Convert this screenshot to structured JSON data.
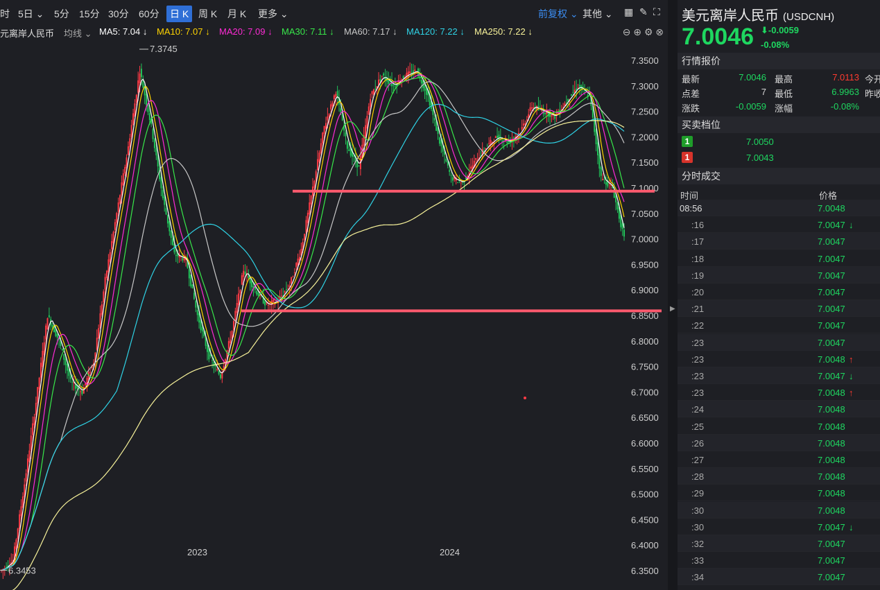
{
  "toolbar": {
    "items": [
      "时",
      "5日 ⌄",
      "5分",
      "15分",
      "30分",
      "60分",
      "日 K",
      "周 K",
      "月 K",
      "更多 ⌄"
    ],
    "active_index": 6,
    "adjust": "前复权 ⌄",
    "other": "其他 ⌄"
  },
  "ma_bar": {
    "symbol": "元离岸人民币",
    "mode": "均线 ⌄",
    "ma": [
      {
        "label": "MA5: 7.04 ↓",
        "color": "#ffffff"
      },
      {
        "label": "MA10: 7.07 ↓",
        "color": "#ffd400"
      },
      {
        "label": "MA20: 7.09 ↓",
        "color": "#ff2bd6"
      },
      {
        "label": "MA30: 7.11 ↓",
        "color": "#38e84a"
      },
      {
        "label": "MA60: 7.17 ↓",
        "color": "#c8c8c8"
      },
      {
        "label": "MA120: 7.22 ↓",
        "color": "#2fd3e6"
      },
      {
        "label": "MA250: 7.22 ↓",
        "color": "#f7f29a"
      }
    ]
  },
  "chart_data": {
    "type": "candlestick",
    "y_ticks": [
      "7.3500",
      "7.3000",
      "7.2500",
      "7.2000",
      "7.1500",
      "7.1000",
      "7.0500",
      "7.0000",
      "6.9500",
      "6.9000",
      "6.8500",
      "6.8000",
      "6.7500",
      "6.7000",
      "6.6500",
      "6.6000",
      "6.5500",
      "6.5000",
      "6.4500",
      "6.4000",
      "6.3500"
    ],
    "ylim": [
      6.33,
      7.39
    ],
    "x_labels": [
      "2023",
      "2024"
    ],
    "high_marker": "7.3745",
    "low_marker": "6.3453",
    "high_value": 7.3745,
    "low_value": 6.3453,
    "support_lines": [
      7.0935,
      6.859
    ],
    "price_path": [
      6.35,
      6.37,
      6.52,
      6.68,
      6.85,
      6.8,
      6.72,
      6.7,
      6.76,
      6.92,
      7.05,
      7.18,
      7.33,
      7.22,
      7.08,
      6.97,
      6.96,
      6.85,
      6.77,
      6.73,
      6.82,
      6.94,
      6.9,
      6.87,
      6.88,
      6.91,
      6.98,
      7.1,
      7.22,
      7.29,
      7.18,
      7.14,
      7.28,
      7.32,
      7.3,
      7.32,
      7.33,
      7.28,
      7.19,
      7.12,
      7.11,
      7.15,
      7.18,
      7.2,
      7.19,
      7.21,
      7.26,
      7.25,
      7.24,
      7.27,
      7.3,
      7.28,
      7.12,
      7.1,
      7.0
    ]
  },
  "quote": {
    "title": "美元离岸人民币",
    "code": "(USDCNH)",
    "price": "7.0046",
    "change": "⬇-0.0059",
    "change_pct": "-0.08%",
    "section": "行情报价",
    "rows": [
      {
        "l1": "最新",
        "v1": "7.0046",
        "c1": "green",
        "l2": "最高",
        "v2": "7.0113",
        "c2": "red",
        "l3": "今开"
      },
      {
        "l1": "点差",
        "v1": "7",
        "c1": "plain",
        "l2": "最低",
        "v2": "6.9963",
        "c2": "green",
        "l3": "昨收"
      },
      {
        "l1": "涨跌",
        "v1": "-0.0059",
        "c1": "green",
        "l2": "涨幅",
        "v2": "-0.08%",
        "c2": "green",
        "l3": ""
      }
    ]
  },
  "orderbook": {
    "section": "买卖档位",
    "levels": [
      {
        "badge": "1",
        "price": "7.0050",
        "color": "#1f9d2a"
      },
      {
        "badge": "1",
        "price": "7.0043",
        "color": "#d7332b"
      }
    ]
  },
  "trades": {
    "section": "分时成交",
    "col_time": "时间",
    "col_price": "价格",
    "rows": [
      {
        "time": "08:56",
        "price": "7.0048",
        "arrow": ""
      },
      {
        "time": ":16",
        "price": "7.0047",
        "arrow": "down"
      },
      {
        "time": ":17",
        "price": "7.0047",
        "arrow": ""
      },
      {
        "time": ":18",
        "price": "7.0047",
        "arrow": ""
      },
      {
        "time": ":19",
        "price": "7.0047",
        "arrow": ""
      },
      {
        "time": ":20",
        "price": "7.0047",
        "arrow": ""
      },
      {
        "time": ":21",
        "price": "7.0047",
        "arrow": ""
      },
      {
        "time": ":22",
        "price": "7.0047",
        "arrow": ""
      },
      {
        "time": ":23",
        "price": "7.0047",
        "arrow": ""
      },
      {
        "time": ":23",
        "price": "7.0048",
        "arrow": "up"
      },
      {
        "time": ":23",
        "price": "7.0047",
        "arrow": "down"
      },
      {
        "time": ":23",
        "price": "7.0048",
        "arrow": "up"
      },
      {
        "time": ":24",
        "price": "7.0048",
        "arrow": ""
      },
      {
        "time": ":25",
        "price": "7.0048",
        "arrow": ""
      },
      {
        "time": ":26",
        "price": "7.0048",
        "arrow": ""
      },
      {
        "time": ":27",
        "price": "7.0048",
        "arrow": ""
      },
      {
        "time": ":28",
        "price": "7.0048",
        "arrow": ""
      },
      {
        "time": ":29",
        "price": "7.0048",
        "arrow": ""
      },
      {
        "time": ":30",
        "price": "7.0048",
        "arrow": ""
      },
      {
        "time": ":30",
        "price": "7.0047",
        "arrow": "down"
      },
      {
        "time": ":32",
        "price": "7.0047",
        "arrow": ""
      },
      {
        "time": ":33",
        "price": "7.0047",
        "arrow": ""
      },
      {
        "time": ":34",
        "price": "7.0047",
        "arrow": ""
      }
    ]
  }
}
